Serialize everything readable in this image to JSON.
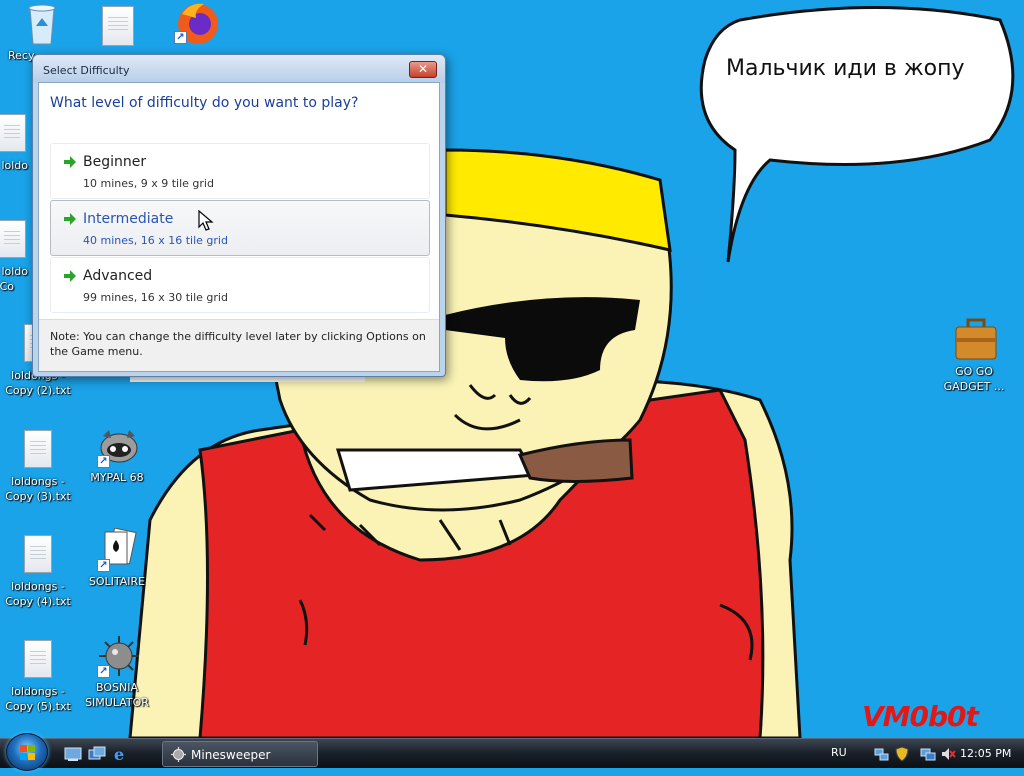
{
  "desktop": {
    "speech_text": "Мальчик иди в жопу",
    "watermark": "VM0b0t",
    "icons": [
      {
        "label": "Recy",
        "icon": "recycle-bin-icon"
      },
      {
        "label": "",
        "icon": "text-file-icon"
      },
      {
        "label": "",
        "icon": "firefox-icon"
      },
      {
        "label": "loldo",
        "icon": "text-file-icon"
      },
      {
        "label": "loldo",
        "icon": "text-file-icon"
      },
      {
        "label": "Co",
        "icon": "text-file-icon"
      },
      {
        "label": "loldongs -",
        "icon": "text-file-icon"
      },
      {
        "label": "Copy (2).txt",
        "icon": "text-file-icon"
      },
      {
        "label": "loldongs -",
        "icon": "text-file-icon"
      },
      {
        "label": "Copy (3).txt",
        "icon": "text-file-icon"
      },
      {
        "label": "loldongs -",
        "icon": "text-file-icon"
      },
      {
        "label": "Copy (4).txt",
        "icon": "text-file-icon"
      },
      {
        "label": "loldongs -",
        "icon": "text-file-icon"
      },
      {
        "label": "Copy (5).txt",
        "icon": "text-file-icon"
      },
      {
        "label": "MYPAL 68",
        "icon": "raccoon-icon"
      },
      {
        "label": "SOLITAIRE",
        "icon": "solitaire-cards-icon"
      },
      {
        "label": "BOSNIA",
        "icon": "mine-icon"
      },
      {
        "label": "SIMULATOR",
        "icon": "mine-icon"
      },
      {
        "label": "GO GO",
        "icon": "briefcase-icon"
      },
      {
        "label": "GADGET ...",
        "icon": "briefcase-icon"
      }
    ]
  },
  "dialog": {
    "title": "Select Difficulty",
    "question": "What level of difficulty do you want to play?",
    "options": [
      {
        "name": "Beginner",
        "desc": "10 mines, 9 x 9 tile grid",
        "hover": false
      },
      {
        "name": "Intermediate",
        "desc": "40 mines, 16 x 16 tile grid",
        "hover": true
      },
      {
        "name": "Advanced",
        "desc": "99 mines, 16 x 30 tile grid",
        "hover": false
      }
    ],
    "note": "Note: You can change the difficulty level later by clicking Options on the Game menu."
  },
  "taskbar": {
    "task_label": "Minesweeper",
    "language": "RU",
    "clock": "12:05 PM"
  },
  "colors": {
    "desktop_bg": "#1aa3e8",
    "accent_blue": "#1a3f9b",
    "arrow_green": "#2aa52a",
    "watermark_red": "#e01818"
  }
}
